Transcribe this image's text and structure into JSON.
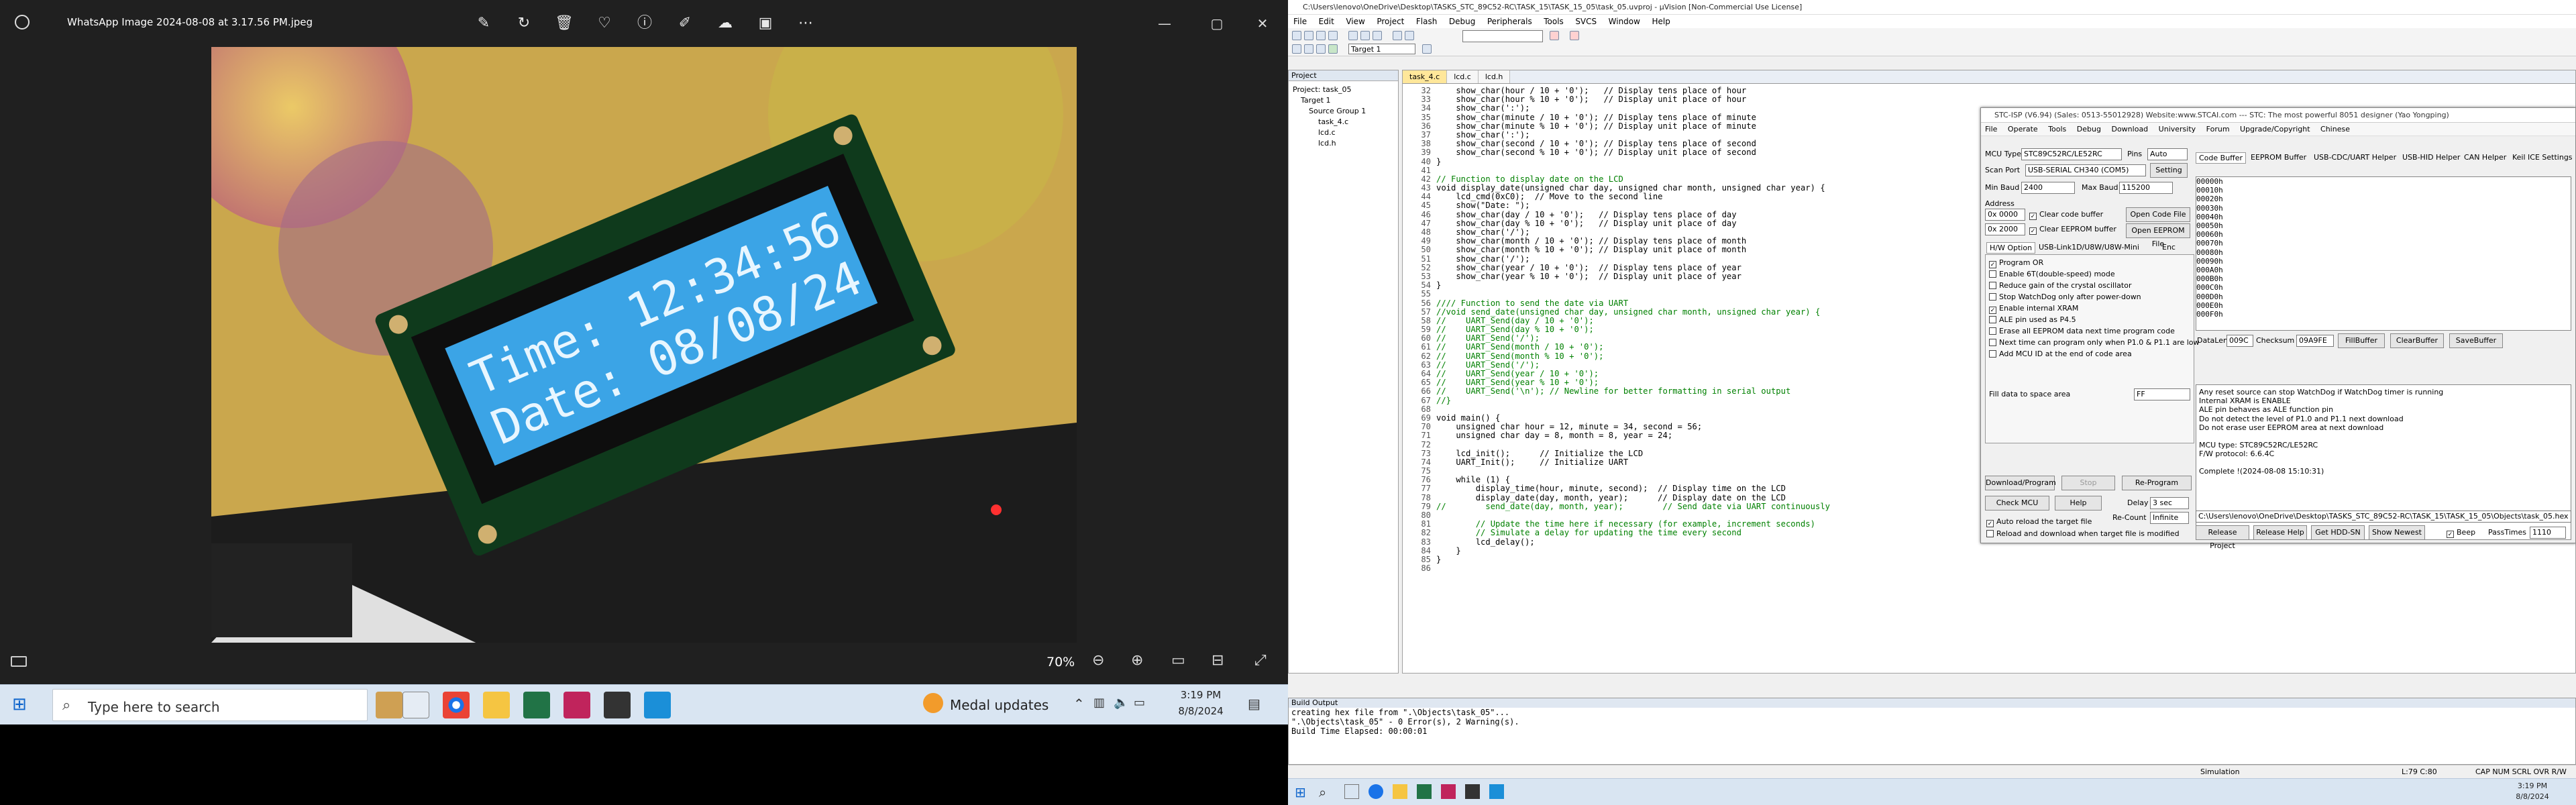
{
  "viewer": {
    "title": "WhatsApp Image 2024-08-08 at 3.17.56 PM.jpeg",
    "lcd_line1": "Time: 12:34:56",
    "lcd_line2": "Date: 08/08/24",
    "zoom": "70%",
    "tool_icons": [
      "edit-icon",
      "rotate-icon",
      "delete-icon",
      "favorite-icon",
      "info-icon",
      "edit-image-icon",
      "cloud-icon",
      "video-icon",
      "more-icon"
    ]
  },
  "left_taskbar": {
    "search_placeholder": "Type here to search",
    "notification": "Medal updates",
    "time": "3:19 PM",
    "date": "8/8/2024"
  },
  "uv": {
    "title": "C:\\Users\\lenovo\\OneDrive\\Desktop\\TASKS_STC_89C52-RC\\TASK_15\\TASK_15_05\\task_05.uvproj - µVision  [Non-Commercial Use License]",
    "menu": [
      "File",
      "Edit",
      "View",
      "Project",
      "Flash",
      "Debug",
      "Peripherals",
      "Tools",
      "SVCS",
      "Window",
      "Help"
    ],
    "target": "Target 1",
    "project_pane": {
      "title": "Project",
      "nodes": [
        "Project: task_05",
        "Target 1",
        "Source Group 1",
        "task_4.c",
        "lcd.c",
        "lcd.h"
      ]
    },
    "tabs": [
      "task_4.c",
      "lcd.c",
      "lcd.h"
    ],
    "code": [
      {
        "n": "32",
        "t": "    show_char(hour / 10 + '0');   // Display tens place of hour"
      },
      {
        "n": "33",
        "t": "    show_char(hour % 10 + '0');   // Display unit place of hour"
      },
      {
        "n": "34",
        "t": "    show_char(':');"
      },
      {
        "n": "35",
        "t": "    show_char(minute / 10 + '0'); // Display tens place of minute"
      },
      {
        "n": "36",
        "t": "    show_char(minute % 10 + '0'); // Display unit place of minute"
      },
      {
        "n": "37",
        "t": "    show_char(':');"
      },
      {
        "n": "38",
        "t": "    show_char(second / 10 + '0'); // Display tens place of second"
      },
      {
        "n": "39",
        "t": "    show_char(second % 10 + '0'); // Display unit place of second"
      },
      {
        "n": "40",
        "t": "}"
      },
      {
        "n": "41",
        "t": ""
      },
      {
        "n": "42",
        "t": "// Function to display date on the LCD"
      },
      {
        "n": "43",
        "t": "void display_date(unsigned char day, unsigned char month, unsigned char year) {"
      },
      {
        "n": "44",
        "t": "    lcd_cmd(0xC0);  // Move to the second line"
      },
      {
        "n": "45",
        "t": "    show(\"Date: \");"
      },
      {
        "n": "46",
        "t": "    show_char(day / 10 + '0');   // Display tens place of day"
      },
      {
        "n": "47",
        "t": "    show_char(day % 10 + '0');   // Display unit place of day"
      },
      {
        "n": "48",
        "t": "    show_char('/');"
      },
      {
        "n": "49",
        "t": "    show_char(month / 10 + '0'); // Display tens place of month"
      },
      {
        "n": "50",
        "t": "    show_char(month % 10 + '0'); // Display unit place of month"
      },
      {
        "n": "51",
        "t": "    show_char('/');"
      },
      {
        "n": "52",
        "t": "    show_char(year / 10 + '0');  // Display tens place of year"
      },
      {
        "n": "53",
        "t": "    show_char(year % 10 + '0');  // Display unit place of year"
      },
      {
        "n": "54",
        "t": "}"
      },
      {
        "n": "55",
        "t": ""
      },
      {
        "n": "56",
        "t": "//// Function to send the date via UART"
      },
      {
        "n": "57",
        "t": "//void send_date(unsigned char day, unsigned char month, unsigned char year) {"
      },
      {
        "n": "58",
        "t": "//    UART_Send(day / 10 + '0');"
      },
      {
        "n": "59",
        "t": "//    UART_Send(day % 10 + '0');"
      },
      {
        "n": "60",
        "t": "//    UART_Send('/');"
      },
      {
        "n": "61",
        "t": "//    UART_Send(month / 10 + '0');"
      },
      {
        "n": "62",
        "t": "//    UART_Send(month % 10 + '0');"
      },
      {
        "n": "63",
        "t": "//    UART_Send('/');"
      },
      {
        "n": "64",
        "t": "//    UART_Send(year / 10 + '0');"
      },
      {
        "n": "65",
        "t": "//    UART_Send(year % 10 + '0');"
      },
      {
        "n": "66",
        "t": "//    UART_Send('\\n'); // Newline for better formatting in serial output"
      },
      {
        "n": "67",
        "t": "//}"
      },
      {
        "n": "68",
        "t": ""
      },
      {
        "n": "69",
        "t": "void main() {"
      },
      {
        "n": "70",
        "t": "    unsigned char hour = 12, minute = 34, second = 56;"
      },
      {
        "n": "71",
        "t": "    unsigned char day = 8, month = 8, year = 24;"
      },
      {
        "n": "72",
        "t": ""
      },
      {
        "n": "73",
        "t": "    lcd_init();      // Initialize the LCD"
      },
      {
        "n": "74",
        "t": "    UART_Init();     // Initialize UART"
      },
      {
        "n": "75",
        "t": ""
      },
      {
        "n": "76",
        "t": "    while (1) {"
      },
      {
        "n": "77",
        "t": "        display_time(hour, minute, second);  // Display time on the LCD"
      },
      {
        "n": "78",
        "t": "        display_date(day, month, year);      // Display date on the LCD"
      },
      {
        "n": "79",
        "t": "//        send_date(day, month, year);        // Send date via UART continuously"
      },
      {
        "n": "80",
        "t": ""
      },
      {
        "n": "81",
        "t": "        // Update the time here if necessary (for example, increment seconds)"
      },
      {
        "n": "82",
        "t": "        // Simulate a delay for updating the time every second"
      },
      {
        "n": "83",
        "t": "        lcd_delay();"
      },
      {
        "n": "84",
        "t": "    }"
      },
      {
        "n": "85",
        "t": "}"
      },
      {
        "n": "86",
        "t": ""
      }
    ],
    "build": {
      "title": "Build Output",
      "lines": [
        "creating hex file from \".\\Objects\\task_05\"...",
        "\".\\Objects\\task_05\" - 0 Error(s), 2 Warning(s).",
        "Build Time Elapsed:  00:00:01"
      ]
    },
    "status": {
      "sim": "Simulation",
      "pos": "L:79 C:80",
      "caps": "CAP NUM SCRL OVR R/W"
    }
  },
  "stc": {
    "title": "STC-ISP (V6.94) (Sales: 0513-55012928) Website:www.STCAI.com  --- STC: The most powerful 8051 designer (Yao Yongping)",
    "menu": [
      "File",
      "Operate",
      "Tools",
      "Debug",
      "Download",
      "University",
      "Forum",
      "Upgrade/Copyright",
      "Chinese"
    ],
    "mcu_type_label": "MCU Type",
    "mcu_type": "STC89C52RC/LE52RC",
    "pins_label": "Pins",
    "pins": "Auto",
    "scan_label": "Scan Port",
    "port": "USB-SERIAL CH340 (COM5)",
    "setting": "Setting",
    "min_baud_label": "Min Baud",
    "min_baud": "2400",
    "max_baud_label": "Max Baud",
    "max_baud": "115200",
    "address_label": "Address",
    "addr1": "0x 0000",
    "addr2": "0x 2000",
    "clear_code": "Clear code buffer",
    "clear_eeprom": "Clear EEPROM buffer",
    "open_code": "Open Code File",
    "open_eeprom": "Open EEPROM File",
    "hw_tab": "H/W Option",
    "usb_tab": "USB-Link1D/U8W/U8W-Mini",
    "enc_tab": "Enc",
    "options": [
      {
        "label": "Program OR",
        "on": true
      },
      {
        "label": "Enable 6T(double-speed) mode",
        "on": false
      },
      {
        "label": "Reduce gain of the crystal oscillator",
        "on": false
      },
      {
        "label": "Stop WatchDog only after power-down",
        "on": false
      },
      {
        "label": "Enable internal XRAM",
        "on": true
      },
      {
        "label": "ALE pin used as P4.5",
        "on": false
      },
      {
        "label": "Erase all EEPROM data next time program code",
        "on": false
      },
      {
        "label": "Next time can program only when P1.0 & P1.1 are low",
        "on": false
      },
      {
        "label": "Add MCU ID at the end of code area",
        "on": false
      }
    ],
    "fill_label": "Fill data to space area",
    "fill_value": "FF",
    "download_btn": "Download/Program",
    "stop_btn": "Stop",
    "reprogram_btn": "Re-Program",
    "check_btn": "Check MCU",
    "help_btn": "Help",
    "delay_label": "Delay",
    "delay_value": "3 sec",
    "recount_label": "Re-Count",
    "recount_value": "Infinite",
    "auto_reload": "Auto reload the target file",
    "reload_download": "Reload and download when target file is modified",
    "rtabs": [
      "Code Buffer",
      "EEPROM Buffer",
      "USB-CDC/UART Helper",
      "USB-HID Helper",
      "CAN Helper",
      "Keil ICE Settings"
    ],
    "hex_rows": [
      "00000h",
      "00010h",
      "00020h",
      "00030h",
      "00040h",
      "00050h",
      "00060h",
      "00070h",
      "00080h",
      "00090h",
      "000A0h",
      "000B0h",
      "000C0h",
      "000D0h",
      "000E0h",
      "000F0h"
    ],
    "dataline": {
      "len_label": "DataLen",
      "len": "009C",
      "chk_label": "Checksum",
      "chk": "09A9FE",
      "fill": "FillBuffer",
      "clear": "ClearBuffer",
      "save": "SaveBuffer"
    },
    "log": [
      "Any reset source can stop WatchDog if WatchDog timer is running",
      "Internal XRAM is ENABLE",
      "ALE pin behaves as ALE function pin",
      "Do not detect the level of P1.0 and P1.1 next download",
      "Do not erase user EEPROM area at next download",
      "",
      "MCU type: STC89C52RC/LE52RC",
      "F/W protocol: 6.6.4C",
      "",
      "Complete !(2024-08-08 15:10:31)"
    ],
    "path": "C:\\Users\\lenovo\\OneDrive\\Desktop\\TASKS_STC_89C52-RC\\TASK_15\\TASK_15_05\\Objects\\task_05.hex",
    "bottom_btns": [
      "Release Project",
      "Release Help",
      "Get HDD-SN",
      "Show Newest"
    ],
    "beep": "Beep",
    "passtimes": "PassTimes",
    "passtimes_value": "1110"
  },
  "right_taskbar": {
    "time": "3:19 PM",
    "date": "8/8/2024"
  }
}
